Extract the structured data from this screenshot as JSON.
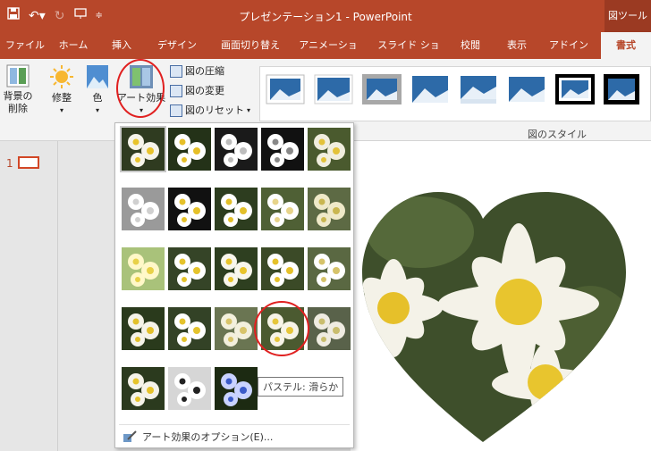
{
  "window": {
    "title": "プレゼンテーション1 - PowerPoint",
    "context_tab": "図ツール"
  },
  "tabs": [
    "ファイル",
    "ホーム",
    "挿入",
    "デザイン",
    "画面切り替え",
    "アニメーション",
    "スライド ショー",
    "校閲",
    "表示",
    "アドイン",
    "書式"
  ],
  "ribbon": {
    "remove_bg": "背景の\n削除",
    "corrections": "修整",
    "color": "色",
    "art_effects": "アート効果",
    "compress": "図の圧縮",
    "change": "図の変更",
    "reset": "図のリセット",
    "styles_group_label": "図のスタイル"
  },
  "slides": {
    "current_number": "1"
  },
  "art_menu": {
    "options_label": "アート効果のオプション(E)...",
    "tooltip": "パステル: 滑らか"
  },
  "colors": {
    "accent": "#b7472a",
    "circle": "#e02020"
  }
}
